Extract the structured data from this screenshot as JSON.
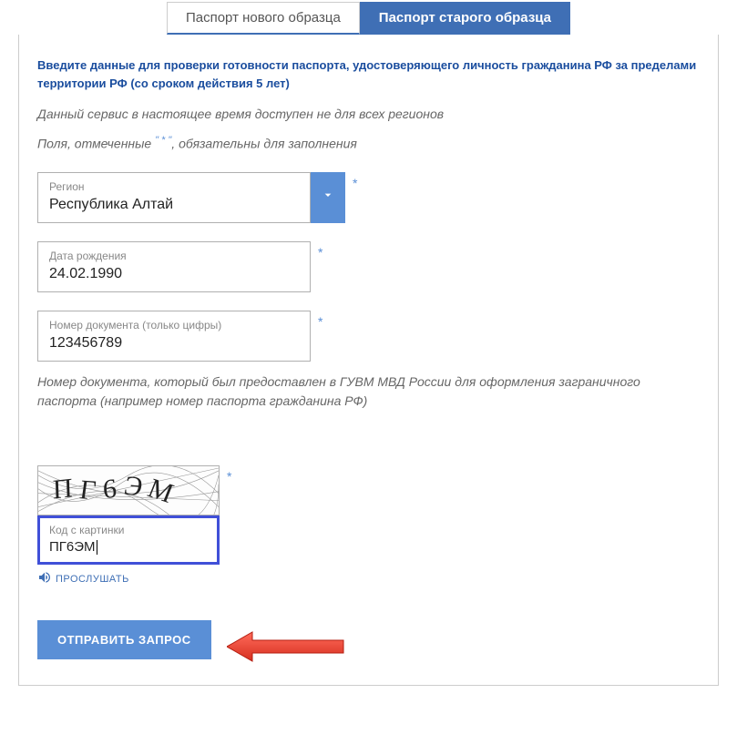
{
  "tabs": {
    "new_passport": "Паспорт нового образца",
    "old_passport": "Паспорт старого образца"
  },
  "intro": {
    "bold": "Введите данные для проверки готовности паспорта, удостоверяющего личность гражданина РФ за пределами территории РФ (со сроком действия 5 лет)",
    "italic1": "Данный сервис в настоящее время доступен не для всех регионов",
    "italic2_pre": "Поля, отмеченные ",
    "italic2_star": "\" * \"",
    "italic2_post": ", обязательны для заполнения"
  },
  "fields": {
    "region": {
      "label": "Регион",
      "value": "Республика Алтай"
    },
    "dob": {
      "label": "Дата рождения",
      "value": "24.02.1990"
    },
    "docnum": {
      "label": "Номер документа (только цифры)",
      "value": "123456789"
    }
  },
  "doc_note": "Номер документа, который был предоставлен в ГУВМ МВД России для оформления заграничного паспорта (например номер паспорта гражданина РФ)",
  "captcha": {
    "glyphs": "ПГ6ЭМ",
    "input_label": "Код с картинки",
    "input_value": "ПГ6ЭМ",
    "listen": "ПРОСЛУШАТЬ"
  },
  "submit": "ОТПРАВИТЬ ЗАПРОС"
}
